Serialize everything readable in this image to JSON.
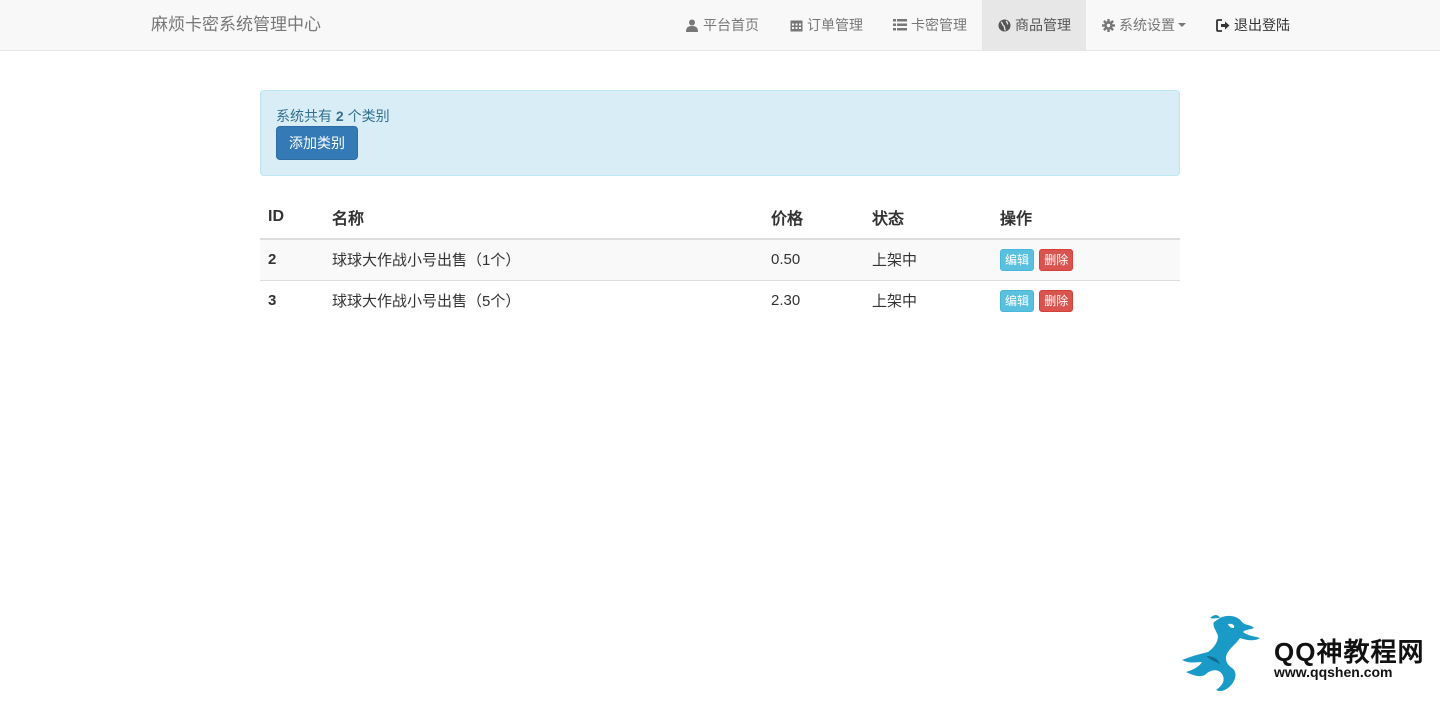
{
  "navbar": {
    "brand": "麻烦卡密系统管理中心",
    "items": [
      {
        "label": "平台首页",
        "icon": "user-icon"
      },
      {
        "label": "订单管理",
        "icon": "calendar-icon"
      },
      {
        "label": "卡密管理",
        "icon": "list-icon"
      },
      {
        "label": "商品管理",
        "icon": "globe-icon",
        "active": true
      },
      {
        "label": "系统设置",
        "icon": "gear-icon",
        "dropdown": true
      },
      {
        "label": "退出登陆",
        "icon": "logout-icon"
      }
    ]
  },
  "alert": {
    "prefix": "系统共有",
    "count": "2",
    "suffix": "个类别",
    "add_button": "添加类别"
  },
  "table": {
    "headers": [
      "ID",
      "名称",
      "价格",
      "状态",
      "操作"
    ],
    "rows": [
      {
        "id": "2",
        "name": "球球大作战小号出售（1个）",
        "price": "0.50",
        "status": "上架中",
        "edit": "编辑",
        "delete": "删除"
      },
      {
        "id": "3",
        "name": "球球大作战小号出售（5个）",
        "price": "2.30",
        "status": "上架中",
        "edit": "编辑",
        "delete": "删除"
      }
    ]
  },
  "watermark": {
    "title": "QQ神教程网",
    "url": "www.qqshen.com"
  },
  "colors": {
    "primary": "#337ab7",
    "alert_bg": "#d9edf7",
    "status_green": "#008000",
    "info": "#5bc0de",
    "danger": "#d9534f",
    "logo_blue": "#1a9bc7"
  }
}
